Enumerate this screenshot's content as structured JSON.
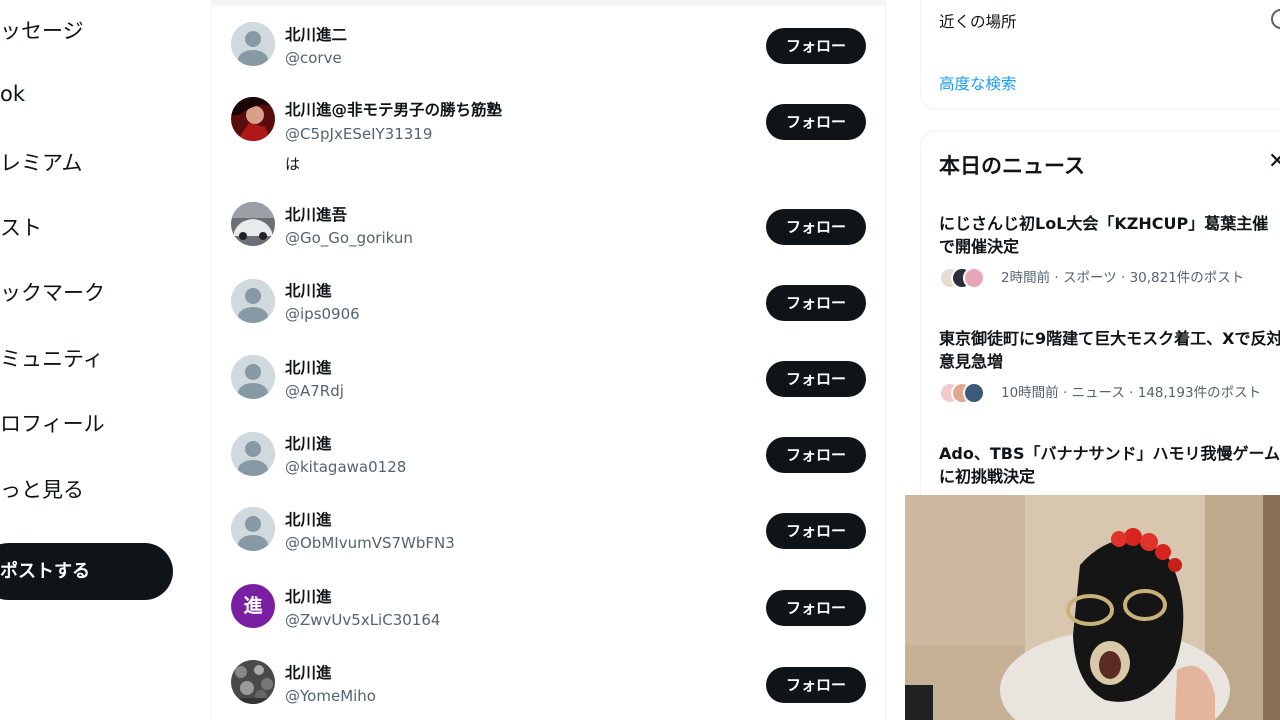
{
  "left_nav": {
    "items": [
      "ッセージ",
      "ok",
      "レミアム",
      "スト",
      "ックマーク",
      "ミュニティ",
      "ロフィール",
      "っと見る"
    ],
    "post_button": "ポストする"
  },
  "users": [
    {
      "name": "北川進二",
      "handle": "@corve",
      "bio": "",
      "follow": "フォロー",
      "avatar": "default-avatar"
    },
    {
      "name": "北川進@非モテ男子の勝ち筋塾",
      "handle": "@C5pJxESeIY31319",
      "bio": "は",
      "follow": "フォロー",
      "avatar": "photo-avatar"
    },
    {
      "name": "北川進吾",
      "handle": "@Go_Go_gorikun",
      "bio": "",
      "follow": "フォロー",
      "avatar": "car-avatar"
    },
    {
      "name": "北川進",
      "handle": "@ips0906",
      "bio": "",
      "follow": "フォロー",
      "avatar": "default-avatar"
    },
    {
      "name": "北川進",
      "handle": "@A7Rdj",
      "bio": "",
      "follow": "フォロー",
      "avatar": "default-avatar"
    },
    {
      "name": "北川進",
      "handle": "@kitagawa0128",
      "bio": "",
      "follow": "フォロー",
      "avatar": "default-avatar"
    },
    {
      "name": "北川進",
      "handle": "@ObMIvumVS7WbFN3",
      "bio": "",
      "follow": "フォロー",
      "avatar": "default-avatar"
    },
    {
      "name": "北川進",
      "handle": "@ZwvUv5xLiC30164",
      "bio": "",
      "follow": "フォロー",
      "avatar": "letter-avatar",
      "avatar_letter": "進"
    },
    {
      "name": "北川進",
      "handle": "@YomeMiho",
      "bio": "",
      "follow": "フォロー",
      "avatar": "mono-photo-avatar"
    }
  ],
  "search_settings": {
    "nearby_label": "近くの場所",
    "advanced_search": "高度な検索"
  },
  "news": {
    "header": "本日のニュース",
    "close_icon": "close-icon",
    "items": [
      {
        "title": "にじさんじ初LoL大会「KZHCUP」葛葉主催で開催決定",
        "meta": "2時間前 · スポーツ · 30,821件のポスト"
      },
      {
        "title": "東京御徒町に9階建て巨大モスク着工、Xで反対意見急増",
        "meta": "10時間前 · ニュース · 148,193件のポスト"
      },
      {
        "title": "Ado、TBS「バナナサンド」ハモリ我慢ゲームに初挑戦決定",
        "meta": ""
      }
    ]
  },
  "colors": {
    "text": "#0f1419",
    "secondary": "#536471",
    "accent": "#1d9bf0",
    "button": "#0f1419"
  }
}
